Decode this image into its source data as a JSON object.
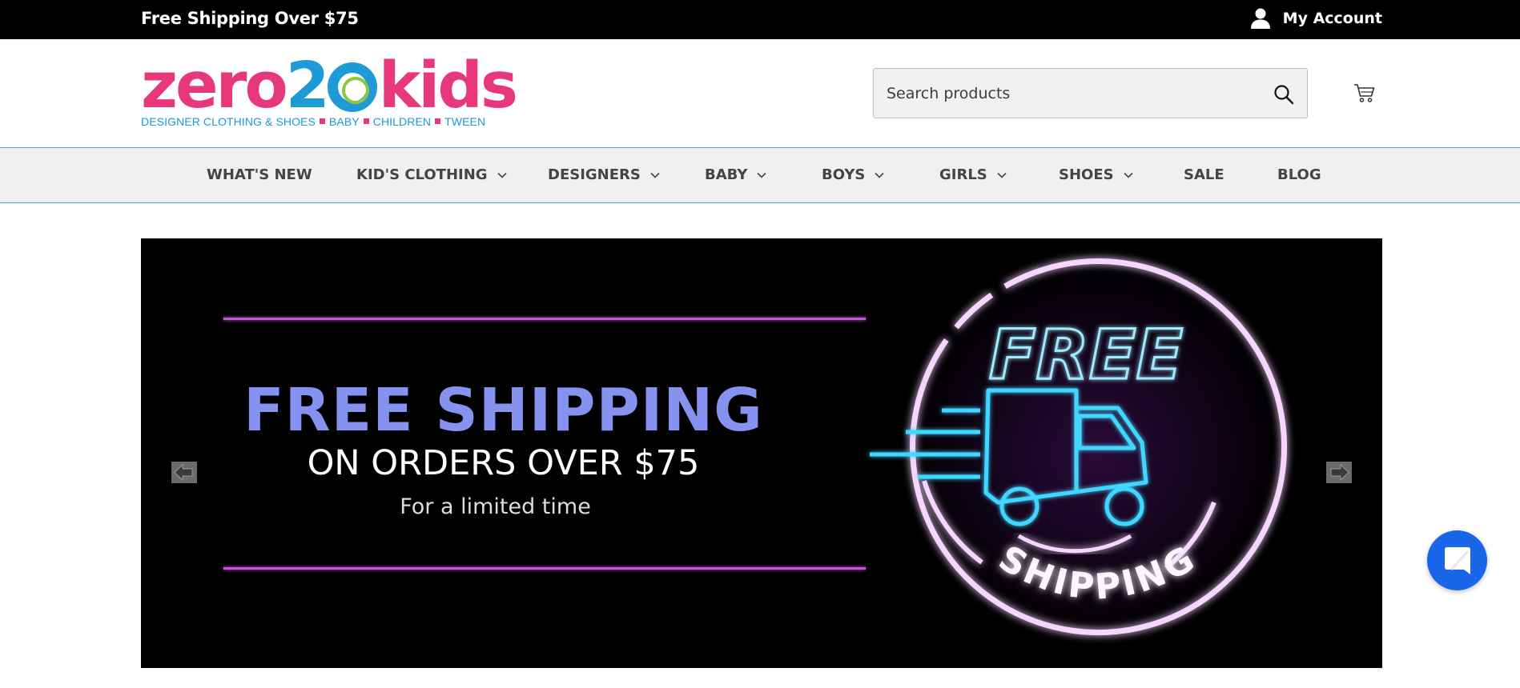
{
  "topbar": {
    "promo": "Free Shipping Over $75",
    "account_label": "My Account"
  },
  "logo": {
    "word_a": "zero2",
    "word_b": "kids",
    "tagline_parts": [
      "DESIGNER CLOTHING & SHOES",
      "BABY",
      "CHILDREN",
      "TWEEN"
    ]
  },
  "search": {
    "placeholder": "Search products"
  },
  "nav": {
    "items": [
      {
        "label": "WHAT'S NEW",
        "dropdown": false
      },
      {
        "label": "KID'S CLOTHING",
        "dropdown": true
      },
      {
        "label": "DESIGNERS",
        "dropdown": true
      },
      {
        "label": "BABY",
        "dropdown": true
      },
      {
        "label": "BOYS",
        "dropdown": true
      },
      {
        "label": "GIRLS",
        "dropdown": true
      },
      {
        "label": "SHOES",
        "dropdown": true
      },
      {
        "label": "SALE",
        "dropdown": false
      },
      {
        "label": "BLOG",
        "dropdown": false
      }
    ]
  },
  "banner": {
    "headline": "FREE SHIPPING",
    "subheadline": "ON ORDERS OVER $75",
    "note": "For a limited time",
    "badge_top": "FREE",
    "badge_bottom": "SHIPPING"
  },
  "colors": {
    "brand_pink": "#e6387a",
    "brand_blue": "#1e9ad6",
    "brand_green": "#8dc63f",
    "neon_purple": "#c45ad6",
    "neon_cyan": "#41d6ff",
    "headline_lavender": "#8592ef",
    "chat_blue": "#1a66e8"
  },
  "icons": {
    "account": "user-icon",
    "search": "search-icon",
    "cart": "cart-icon",
    "chat": "chat-icon",
    "prev": "arrow-left-icon",
    "next": "arrow-right-icon"
  }
}
